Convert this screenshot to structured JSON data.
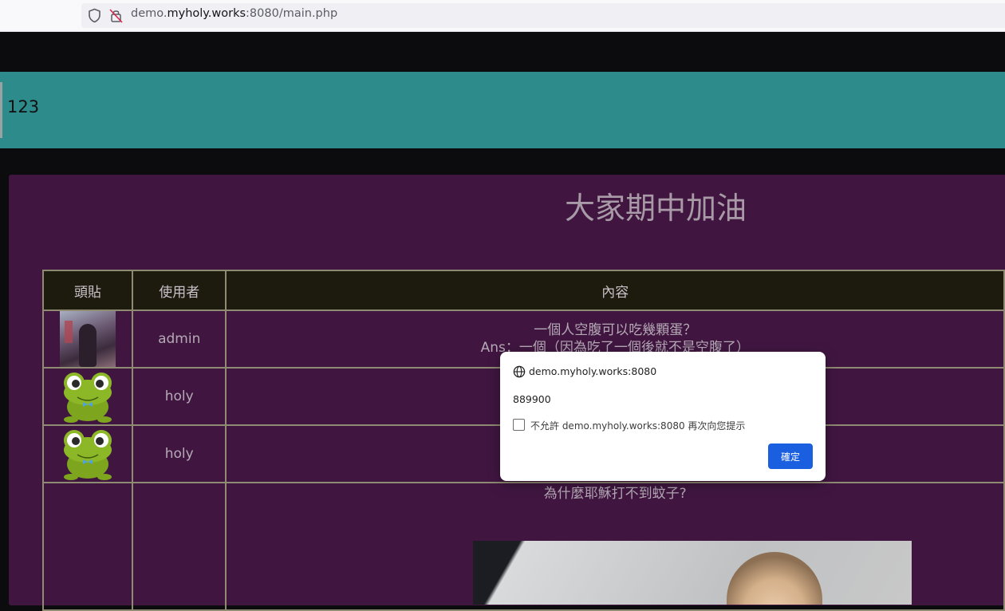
{
  "browser": {
    "url_prefix": "demo.",
    "url_host": "myholy.works",
    "url_suffix": ":8080/main.php"
  },
  "banner": {
    "text": "123"
  },
  "page": {
    "heading": "大家期中加油"
  },
  "table": {
    "headers": [
      "頭貼",
      "使用者",
      "內容"
    ],
    "rows": [
      {
        "avatar": "photo-avatar",
        "user": "admin",
        "content": [
          "一個人空腹可以吃幾顆蛋？",
          "Ans：一個（因為吃了一個後就不是空腹了）"
        ]
      },
      {
        "avatar": "frog-avatar",
        "user": "holy",
        "content": []
      },
      {
        "avatar": "frog-avatar",
        "user": "holy",
        "content": []
      },
      {
        "avatar": "",
        "user": "",
        "content": [
          "為什麼耶穌打不到蚊子?"
        ]
      }
    ]
  },
  "dialog": {
    "origin": "demo.myholy.works:8080",
    "message": "889900",
    "checkbox_label": "不允許 demo.myholy.works:8080 再次向您提示",
    "checkbox_checked": false,
    "ok_label": "確定"
  },
  "colors": {
    "banner": "#2e8b8b",
    "panel": "#401641",
    "header_row": "#1d1a0e",
    "dialog_button": "#1a5fe0"
  }
}
